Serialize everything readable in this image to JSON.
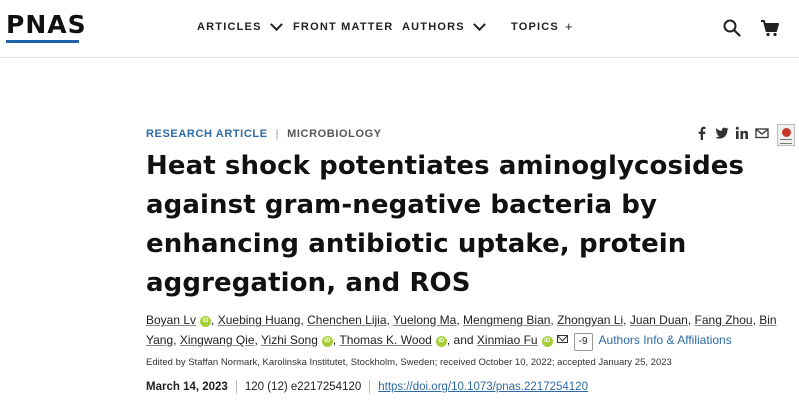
{
  "header": {
    "logo": "PNAS",
    "nav": [
      {
        "label": "ARTICLES"
      },
      {
        "label": "FRONT MATTER"
      },
      {
        "label": "AUTHORS"
      },
      {
        "label": "TOPICS"
      }
    ],
    "topics_symbol": "+"
  },
  "article": {
    "type": "RESEARCH ARTICLE",
    "separator": "|",
    "subject": "MICROBIOLOGY",
    "title": "Heat shock potentiates aminoglycosides against gram-negative bacteria by enhancing antibiotic uptake, protein aggregation, and ROS",
    "authors": [
      "Boyan Lv",
      "Xuebing Huang",
      "Chenchen Lijia",
      "Yuelong Ma",
      "Mengmeng Bian",
      "Zhongyan Li",
      "Juan Duan",
      "Fang Zhou",
      "Bin Yang",
      "Xingwang Qie",
      "Yizhi Song",
      "Thomas K. Wood",
      "Xinmiao Fu"
    ],
    "and_text": ", and",
    "more_authors": "-9",
    "affiliations_link": "Authors Info & Affiliations",
    "edited_by": "Edited by Staffan Normark, Karolinska Institutet, Stockholm, Sweden; received October 10, 2022; accepted January 25, 2023",
    "pub_date": "March 14, 2023",
    "citation": "120 (12) e2217254120",
    "doi": "https://doi.org/10.1073/pnas.2217254120"
  },
  "colors": {
    "accent": "#2d6aa6",
    "logo_underline": "#1f63a8",
    "orcid": "#a6ce39"
  }
}
